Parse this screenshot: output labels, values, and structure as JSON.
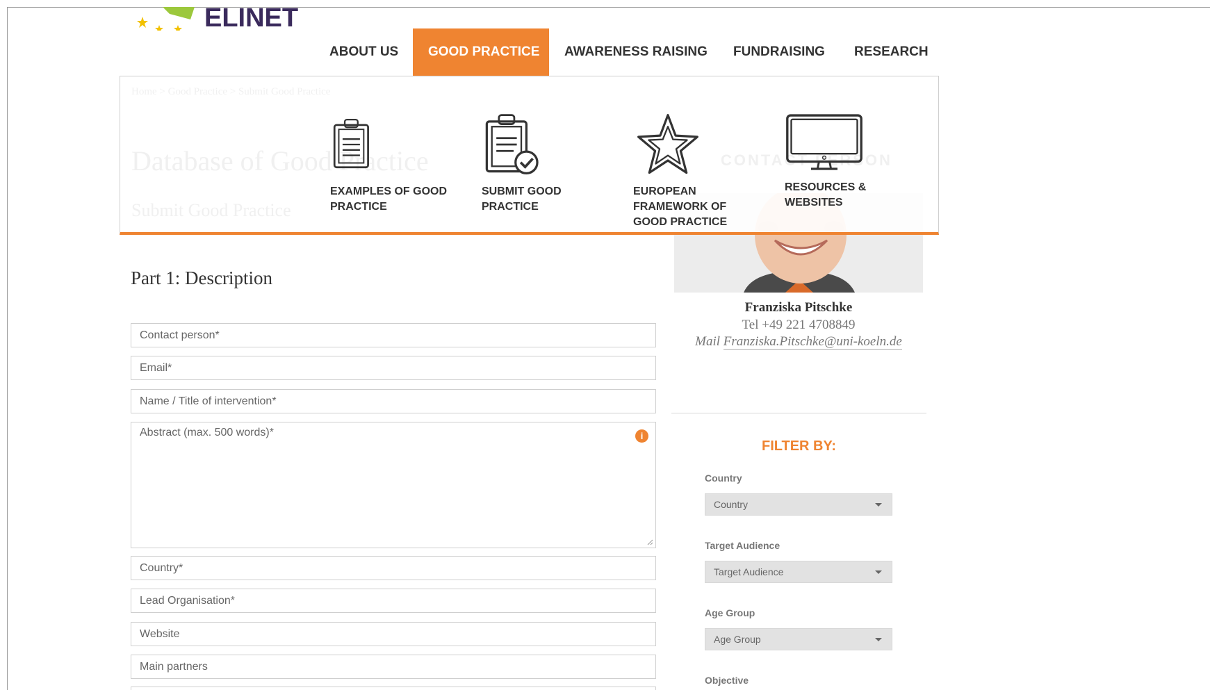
{
  "logo": {
    "text": "ELINET"
  },
  "nav": {
    "items": [
      {
        "label": "ABOUT US"
      },
      {
        "label": "GOOD PRACTICE"
      },
      {
        "label": "AWARENESS RAISING"
      },
      {
        "label": "FUNDRAISING"
      },
      {
        "label": "RESEARCH"
      }
    ]
  },
  "background": {
    "breadcrumb": "Home  >  Good Practice  >  Submit Good Practice",
    "page_title": "Database of Good Practice",
    "page_subtitle": "Submit Good Practice",
    "contact_heading": "CONTACT PERSON"
  },
  "dropdown": {
    "items": [
      {
        "label_line1": "EXAMPLES OF GOOD",
        "label_line2": "PRACTICE",
        "icon": "clipboard-icon"
      },
      {
        "label_line1": "SUBMIT GOOD",
        "label_line2": "PRACTICE",
        "icon": "clipboard-check-icon"
      },
      {
        "label_line1": "EUROPEAN",
        "label_line2": "FRAMEWORK OF",
        "label_line3": "GOOD PRACTICE",
        "icon": "star-icon"
      },
      {
        "label_line1": "RESOURCES &",
        "label_line2": "WEBSITES",
        "icon": "monitor-icon"
      }
    ]
  },
  "form": {
    "heading": "Part 1: Description",
    "fields": {
      "contact_person": "Contact person*",
      "email": "Email*",
      "name_title": "Name / Title of intervention*",
      "abstract": "Abstract (max. 500 words)*",
      "country": "Country*",
      "lead_org": "Lead Organisation*",
      "website": "Website",
      "main_partners": "Main partners"
    }
  },
  "contact": {
    "name": "Franziska Pitschke",
    "tel": "Tel +49 221 4708849",
    "mail_label": "Mail",
    "mail": "Franziska.Pitschke@uni-koeln.de"
  },
  "filter": {
    "title": "FILTER BY:",
    "country_label": "Country",
    "country_value": "Country",
    "audience_label": "Target Audience",
    "audience_value": "Target Audience",
    "age_label": "Age Group",
    "age_value": "Age Group",
    "objective_label": "Objective"
  },
  "colors": {
    "accent": "#ef8431",
    "logo": "#3a2a5c",
    "star": "#f2c100"
  }
}
